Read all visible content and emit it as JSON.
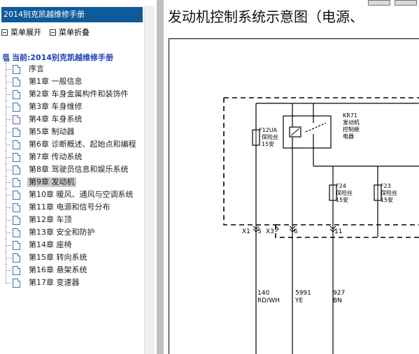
{
  "sidebar": {
    "title": "2014别克凯越维修手册",
    "expand_label": "菜单展开",
    "collapse_label": "菜单折叠",
    "root_label": "当前:2014别克凯越维修手册",
    "items": [
      {
        "label": "序言"
      },
      {
        "label": "第1章 一般信息"
      },
      {
        "label": "第2章 车身金属构件和装饰件"
      },
      {
        "label": "第3章 车身维修"
      },
      {
        "label": "第4章 车身系统"
      },
      {
        "label": "第5章 制动器"
      },
      {
        "label": "第6章 诊断概述、起始点和编程"
      },
      {
        "label": "第7章 传动系统"
      },
      {
        "label": "第8章 驾驶员信息和娱乐系统"
      },
      {
        "label": "第9章 发动机",
        "selected": true
      },
      {
        "label": "第10章 暖风、通风与空调系统"
      },
      {
        "label": "第11章 电源和信号分布"
      },
      {
        "label": "第12章 车顶"
      },
      {
        "label": "第13章 安全和防护"
      },
      {
        "label": "第14章 座椅"
      },
      {
        "label": "第15章 转向系统"
      },
      {
        "label": "第16章 悬架系统"
      },
      {
        "label": "第17章 变速器"
      }
    ]
  },
  "document": {
    "title": "发动机控制系统示意图（电源、"
  },
  "diagram": {
    "relay": {
      "id": "KR71",
      "name1": "发动机",
      "name2": "控制继",
      "name3": "电器"
    },
    "fuses": [
      {
        "id": "F12UA",
        "l1": "保险丝",
        "l2": "15安"
      },
      {
        "id": "F24",
        "l1": "保险丝",
        "l2": "15安"
      },
      {
        "id": "F23",
        "l1": "保险丝",
        "l2": "15安"
      }
    ],
    "connectors": {
      "x1": "X1",
      "x1_pin": "5",
      "x3": "X3",
      "pin6": "6",
      "pin11": "11"
    },
    "wires": [
      {
        "circuit": "140",
        "color": "RD/WH"
      },
      {
        "circuit": "5991",
        "color": "YE"
      },
      {
        "circuit": "927",
        "color": "BN"
      }
    ]
  }
}
